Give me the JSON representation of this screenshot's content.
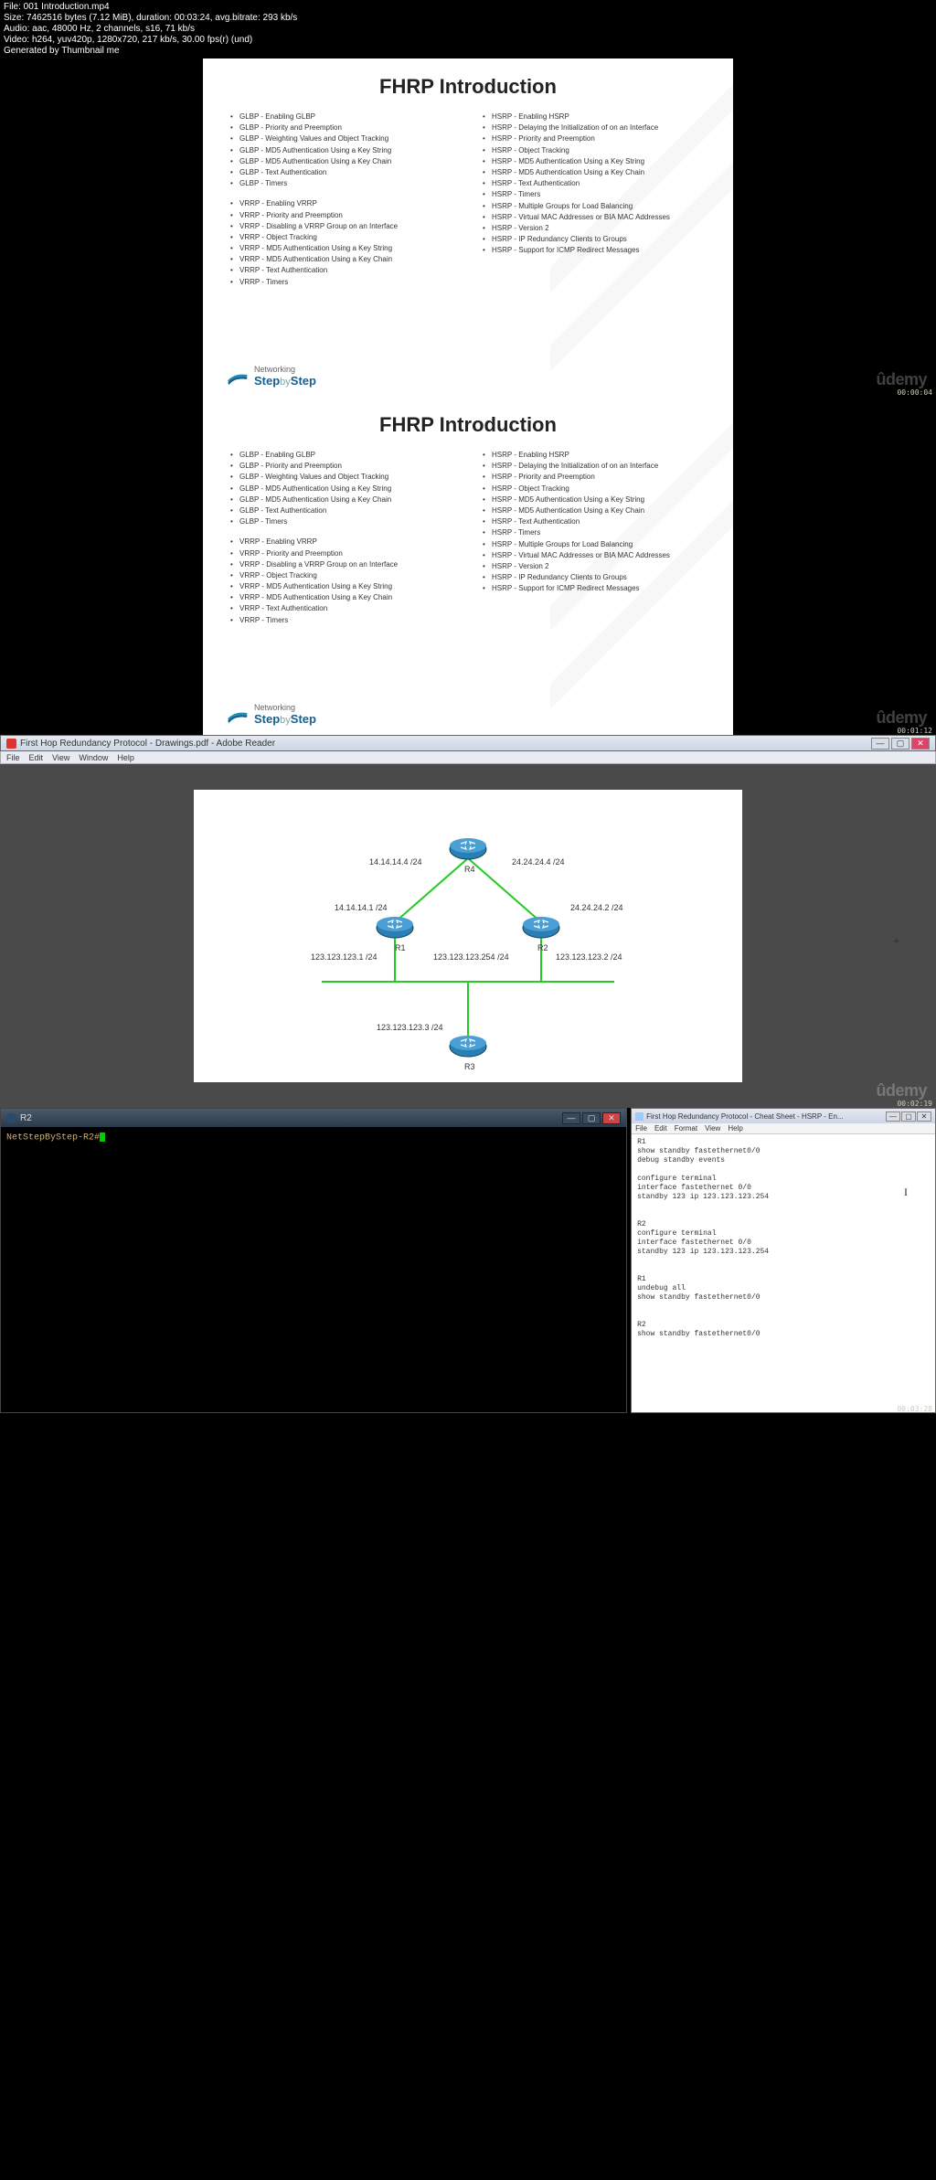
{
  "overlay": {
    "file": "File: 001 Introduction.mp4",
    "size": "Size: 7462516 bytes (7.12 MiB), duration: 00:03:24, avg.bitrate: 293 kb/s",
    "audio": "Audio: aac, 48000 Hz, 2 channels, s16, 71 kb/s",
    "video": "Video: h264, yuv420p, 1280x720, 217 kb/s, 30.00 fps(r) (und)",
    "gen": "Generated by Thumbnail me"
  },
  "slide": {
    "title": "FHRP Introduction",
    "left1": [
      "GLBP - Enabling GLBP",
      "GLBP - Priority and Preemption",
      "GLBP - Weighting Values and Object Tracking",
      "GLBP - MD5 Authentication Using a Key String",
      "GLBP - MD5 Authentication Using a Key Chain",
      "GLBP - Text Authentication",
      "GLBP - Timers"
    ],
    "left2": [
      "VRRP - Enabling VRRP",
      "VRRP - Priority and Preemption",
      "VRRP - Disabling a VRRP Group on an Interface",
      "VRRP - Object Tracking",
      "VRRP - MD5 Authentication Using a Key String",
      "VRRP - MD5 Authentication Using a Key Chain",
      "VRRP - Text Authentication",
      "VRRP - Timers"
    ],
    "right": [
      "HSRP - Enabling HSRP",
      "HSRP - Delaying the Initialization of on an Interface",
      "HSRP - Priority and Preemption",
      "HSRP - Object Tracking",
      "HSRP - MD5 Authentication Using a Key String",
      "HSRP - MD5 Authentication Using a Key Chain",
      "HSRP - Text Authentication",
      "HSRP - Timers",
      "HSRP - Multiple Groups for Load Balancing",
      "HSRP - Virtual MAC Addresses or BIA MAC Addresses",
      "HSRP - Version 2",
      "HSRP - IP Redundancy Clients to Groups",
      "HSRP - Support for ICMP Redirect Messages"
    ],
    "logo": {
      "top": "Networking",
      "main": "Step",
      "by": "by",
      "main2": "Step"
    },
    "watermark": "ûdemy",
    "ts1": "00:00:04",
    "ts2": "00:01:12"
  },
  "pdfwin": {
    "title": "First Hop Redundancy Protocol - Drawings.pdf - Adobe Reader",
    "menu": [
      "File",
      "Edit",
      "View",
      "Window",
      "Help"
    ],
    "labels": {
      "r4_left": "14.14.14.4 /24",
      "r4_right": "24.24.24.4 /24",
      "r4": "R4",
      "r1_top": "14.14.14.1 /24",
      "r2_top": "24.24.24.2 /24",
      "r1_bot": "123.123.123.1 /24",
      "r1": "R1",
      "mid": "123.123.123.254 /24",
      "r2": "R2",
      "r2_bot": "123.123.123.2 /24",
      "r3_top": "123.123.123.3 /24",
      "r3": "R3"
    },
    "ts": "00:02:19"
  },
  "terminal": {
    "title": "R2",
    "prompt": "NetStepByStep-R2#"
  },
  "notepad": {
    "title": "First Hop Redundancy Protocol - Cheat Sheet - HSRP - En...",
    "menu": [
      "File",
      "Edit",
      "Format",
      "View",
      "Help"
    ],
    "content": "R1\nshow standby fastethernet0/0\ndebug standby events\n\nconfigure terminal\ninterface fastethernet 0/0\nstandby 123 ip 123.123.123.254\n\n\nR2\nconfigure terminal\ninterface fastethernet 0/0\nstandby 123 ip 123.123.123.254\n\n\nR1\nundebug all\nshow standby fastethernet0/0\n\n\nR2\nshow standby fastethernet0/0"
  },
  "bottom_ts": "00:03:28"
}
